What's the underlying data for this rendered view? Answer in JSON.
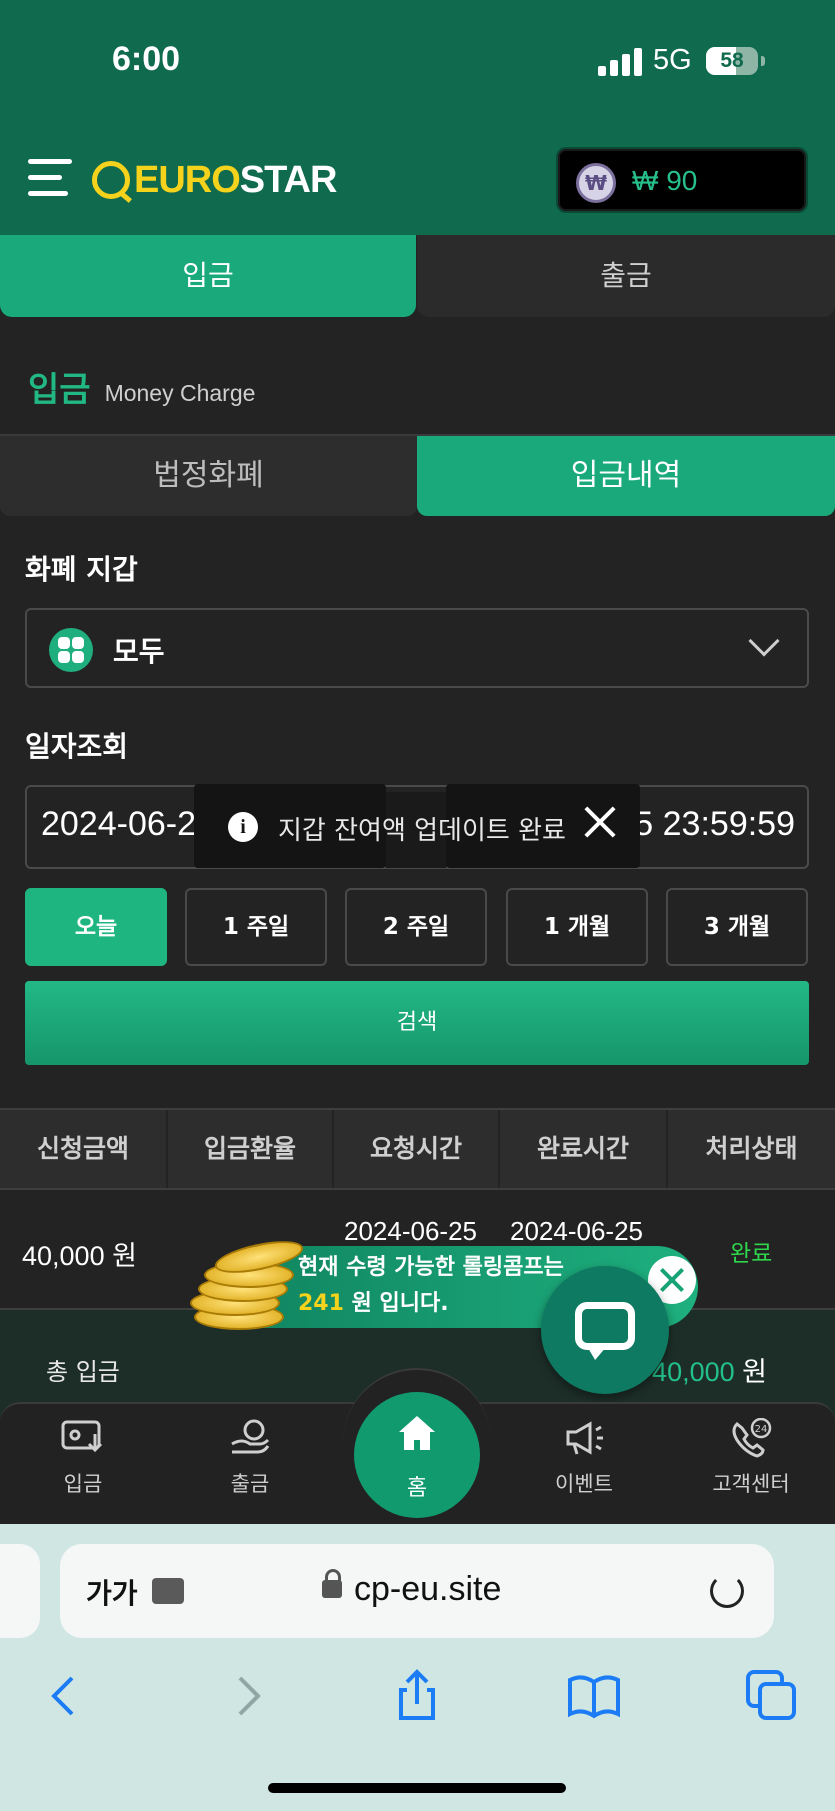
{
  "status_bar": {
    "time": "6:00",
    "network": "5G",
    "battery": "58",
    "battery_level": 0.58
  },
  "header": {
    "menu_icon": "hamburger-icon",
    "logo_part1": "EURO",
    "logo_part2": "STAR",
    "wallet_coin_symbol": "₩",
    "wallet_amount": "₩ 90"
  },
  "top_tabs": {
    "deposit": "입금",
    "withdraw": "출금"
  },
  "section": {
    "title": "입금",
    "subtitle": "Money Charge"
  },
  "sub_tabs": {
    "fiat": "법정화폐",
    "history": "입금내역"
  },
  "filters": {
    "wallet_label": "화폐 지갑",
    "wallet_value": "모두",
    "date_label": "일자조회",
    "date_start": "2024-06-25 00:00:00",
    "date_end": "2024-06-25 23:59:59",
    "periods": [
      "오늘",
      "1 주일",
      "2 주일",
      "1 개월",
      "3 개월"
    ],
    "search_label": "검색"
  },
  "toast": {
    "message": "지갑 잔여액 업데이트 완료",
    "icon": "info-icon"
  },
  "table": {
    "headers": [
      "신청금액",
      "입금환율",
      "요청시간",
      "완료시간",
      "처리상태"
    ],
    "rows": [
      {
        "amount": "40,000 원",
        "rate": "",
        "requested": "2024-06-25",
        "completed": "2024-06-25",
        "status": "완료"
      }
    ]
  },
  "total": {
    "label": "총 입금",
    "value": "40,000",
    "unit": "원"
  },
  "promo": {
    "text_before": "현재 수령 가능한 롤링콤프는 ",
    "highlight": "241",
    "text_after": " 원 입니다."
  },
  "bottom_nav": {
    "items": [
      {
        "label": "입금",
        "icon": "deposit-icon"
      },
      {
        "label": "출금",
        "icon": "withdraw-icon"
      },
      {
        "label": "홈",
        "icon": "home-icon"
      },
      {
        "label": "이벤트",
        "icon": "megaphone-icon"
      },
      {
        "label": "고객센터",
        "icon": "support-24-icon"
      }
    ]
  },
  "browser": {
    "aa_label": "가가",
    "url": "cp-eu.site"
  },
  "colors": {
    "brand_green": "#0f6a4e",
    "accent": "#19a97a",
    "logo_yellow": "#f5d21b",
    "status_done": "#2fd54b"
  }
}
